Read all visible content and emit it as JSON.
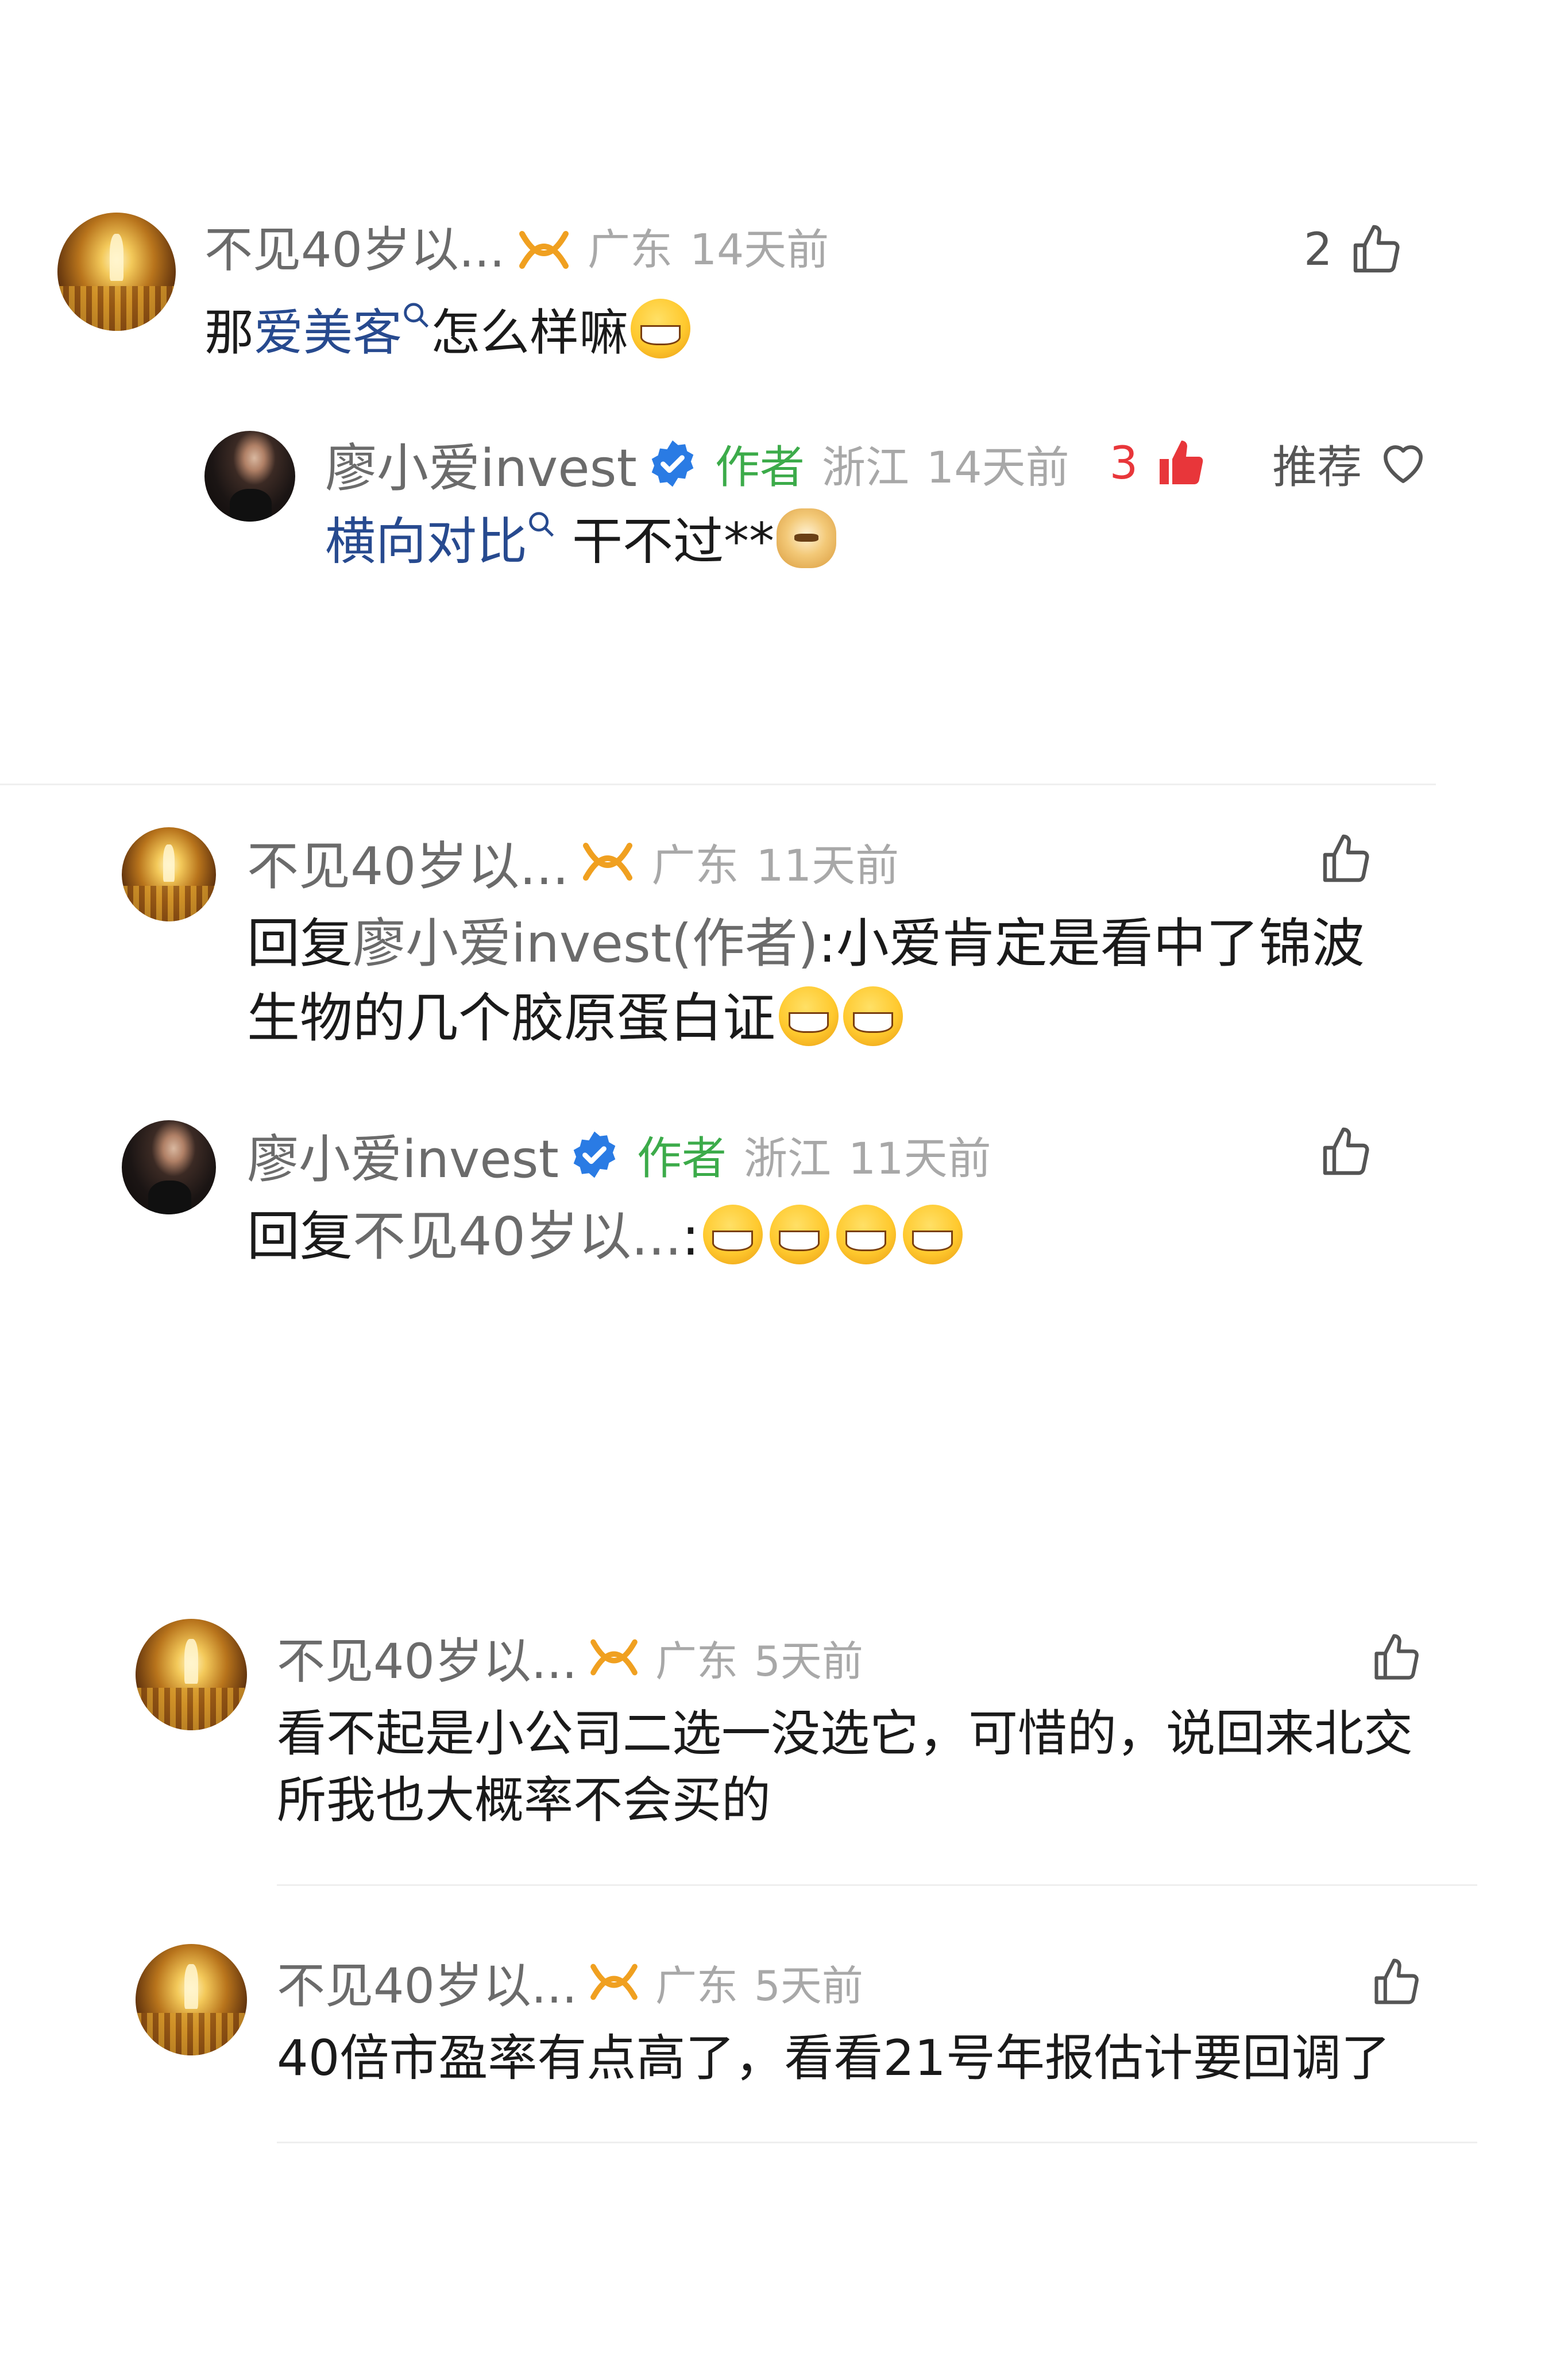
{
  "comments": [
    {
      "username": "不见40岁以...",
      "location": "广东",
      "time": "14天前",
      "likes": "2",
      "text_plain_1": "那",
      "text_link": "爱美客",
      "text_plain_2": "怎么样嘛"
    },
    {
      "username": "廖小爱invest",
      "author_tag": "作者",
      "location": "浙江",
      "time": "14天前",
      "likes": "3",
      "recommend_label": "推荐",
      "text_link": "横向对比",
      "text_plain": " 干不过**"
    },
    {
      "username": "不见40岁以...",
      "location": "广东",
      "time": "11天前",
      "text_reply_prefix": "回复",
      "text_reply_target": "廖小爱invest(作者)",
      "text_body": ":小爱肯定是看中了锦波生物的几个胶原蛋白证"
    },
    {
      "username": "廖小爱invest",
      "author_tag": "作者",
      "location": "浙江",
      "time": "11天前",
      "text_reply_prefix": "回复",
      "text_reply_target": "不见40岁以...",
      "text_body": ":"
    },
    {
      "username": "不见40岁以...",
      "location": "广东",
      "time": "5天前",
      "text": "看不起是小公司二选一没选它，可惜的，说回来北交所我也大概率不会买的"
    },
    {
      "username": "不见40岁以...",
      "location": "广东",
      "time": "5天前",
      "text": "40倍市盈率有点高了，看看21号年报估计要回调了"
    }
  ],
  "colors": {
    "author_green": "#3cab4a",
    "link_blue": "#274a8f",
    "liked_red": "#e8363a",
    "verified_blue": "#2a7be4",
    "badge_orange": "#f0a020"
  }
}
